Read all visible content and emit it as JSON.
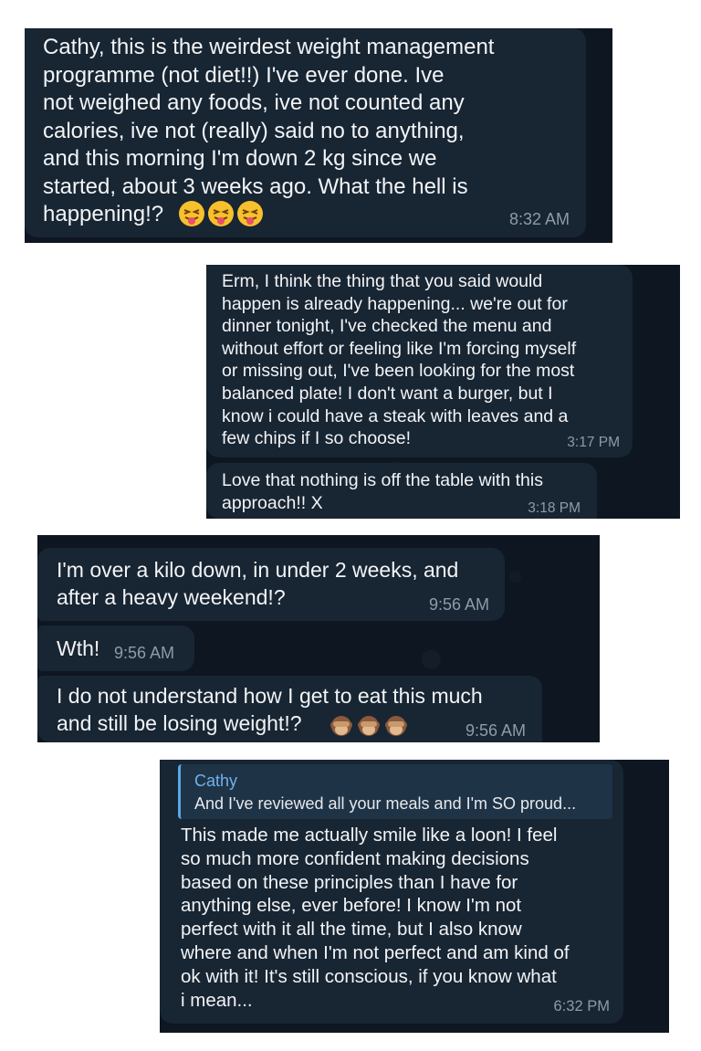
{
  "screenshots": [
    {
      "messages": [
        {
          "text": "Cathy, this is the weirdest weight management\nprogramme (not diet!!) I've ever done. Ive\nnot weighed any foods, ive not counted any\ncalories, ive not (really) said no to anything,\nand this morning I'm down 2 kg since we\nstarted, about 3 weeks ago. What the hell is\nhappening!?",
          "emojis": [
            "face-with-tongue-emoji",
            "face-with-tongue-emoji",
            "face-with-tongue-emoji"
          ],
          "time": "8:32 AM"
        }
      ]
    },
    {
      "messages": [
        {
          "text": "Erm, I think the thing that you said would\nhappen is already happening... we're out for\ndinner tonight, I've checked the menu and\nwithout effort or feeling like I'm forcing myself\nor missing out, I've been looking for the most\nbalanced plate! I don't want a burger, but I\nknow i could have a steak with leaves and a\nfew chips if I so choose!",
          "time": "3:17 PM"
        },
        {
          "text": "Love that nothing is off the table with this\napproach!! X",
          "time": "3:18 PM"
        }
      ]
    },
    {
      "messages": [
        {
          "text": "I'm over a kilo down, in under 2 weeks, and\nafter a heavy weekend!?",
          "time": "9:56 AM"
        },
        {
          "text": "Wth!",
          "time": "9:56 AM"
        },
        {
          "text": "I do not understand how I get to eat this much\nand still be losing weight!?",
          "emojis": [
            "see-no-evil-monkey-emoji",
            "see-no-evil-monkey-emoji",
            "see-no-evil-monkey-emoji"
          ],
          "time": "9:56 AM"
        }
      ]
    },
    {
      "messages": [
        {
          "reply": {
            "name": "Cathy",
            "text": "And I've reviewed all your meals and I'm SO proud..."
          },
          "text": "This made me actually smile like a loon! I feel\nso much more confident making decisions\nbased on these principles than I have for\nanything else, ever before! I know I'm not\nperfect with it all the time, but I also know\nwhere and when I'm not perfect and am kind of\nok with it! It's still conscious, if you know what\ni mean...",
          "time": "6:32 PM"
        }
      ]
    }
  ]
}
